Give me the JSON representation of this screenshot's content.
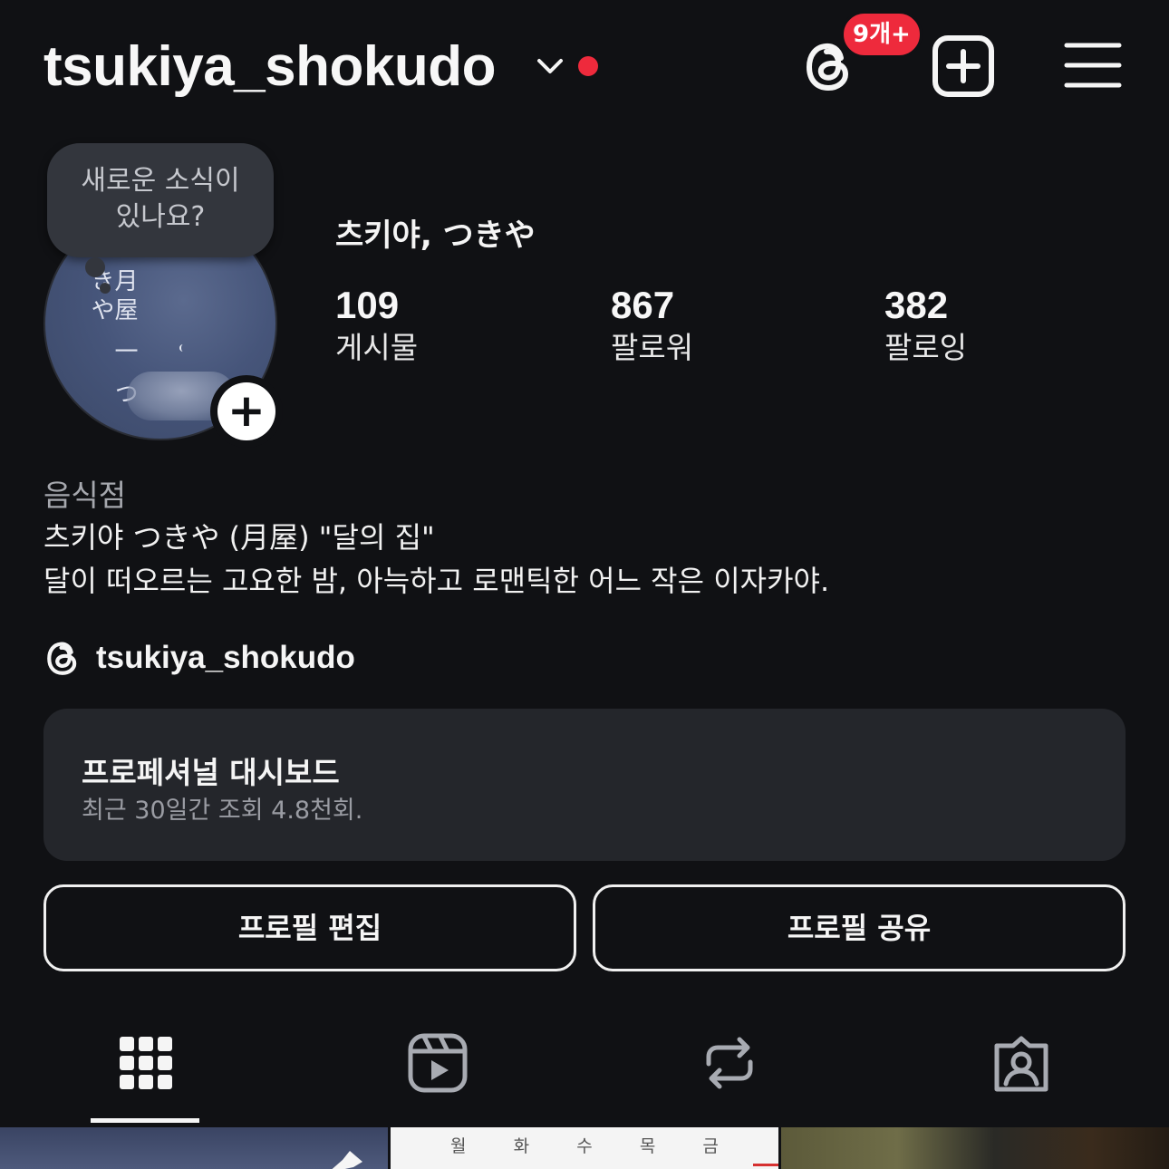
{
  "header": {
    "username": "tsukiya_shokudo",
    "threads_badge": "9개+",
    "accent_red": "#ee2a3c"
  },
  "note": {
    "line1": "새로운 소식이",
    "line2": "있나요?"
  },
  "avatar": {
    "vertical_text": "月屋 一 つきや"
  },
  "profile": {
    "display_name": "츠키야, つきや",
    "stats": {
      "posts": {
        "value": "109",
        "label": "게시물"
      },
      "followers": {
        "value": "867",
        "label": "팔로워"
      },
      "following": {
        "value": "382",
        "label": "팔로잉"
      }
    },
    "category": "음식점",
    "bio_line1": "츠키야 つきや (月屋) \"달의 집\"",
    "bio_line2": "달이 떠오르는 고요한 밤, 아늑하고 로맨틱한 어느 작은 이자카야.",
    "threads_handle": "tsukiya_shokudo"
  },
  "dashboard": {
    "title": "프로페셔널 대시보드",
    "subtitle": "최근 30일간 조회 4.8천회."
  },
  "buttons": {
    "edit": "프로필 편집",
    "share": "프로필 공유"
  },
  "tabs": [
    {
      "name": "grid",
      "icon": "grid-icon",
      "active": true
    },
    {
      "name": "reels",
      "icon": "reels-icon",
      "active": false
    },
    {
      "name": "reposts",
      "icon": "repost-icon",
      "active": false
    },
    {
      "name": "tagged",
      "icon": "tagged-icon",
      "active": false
    }
  ],
  "grid": {
    "calendar_days": [
      "월",
      "화",
      "수",
      "목",
      "금"
    ]
  }
}
